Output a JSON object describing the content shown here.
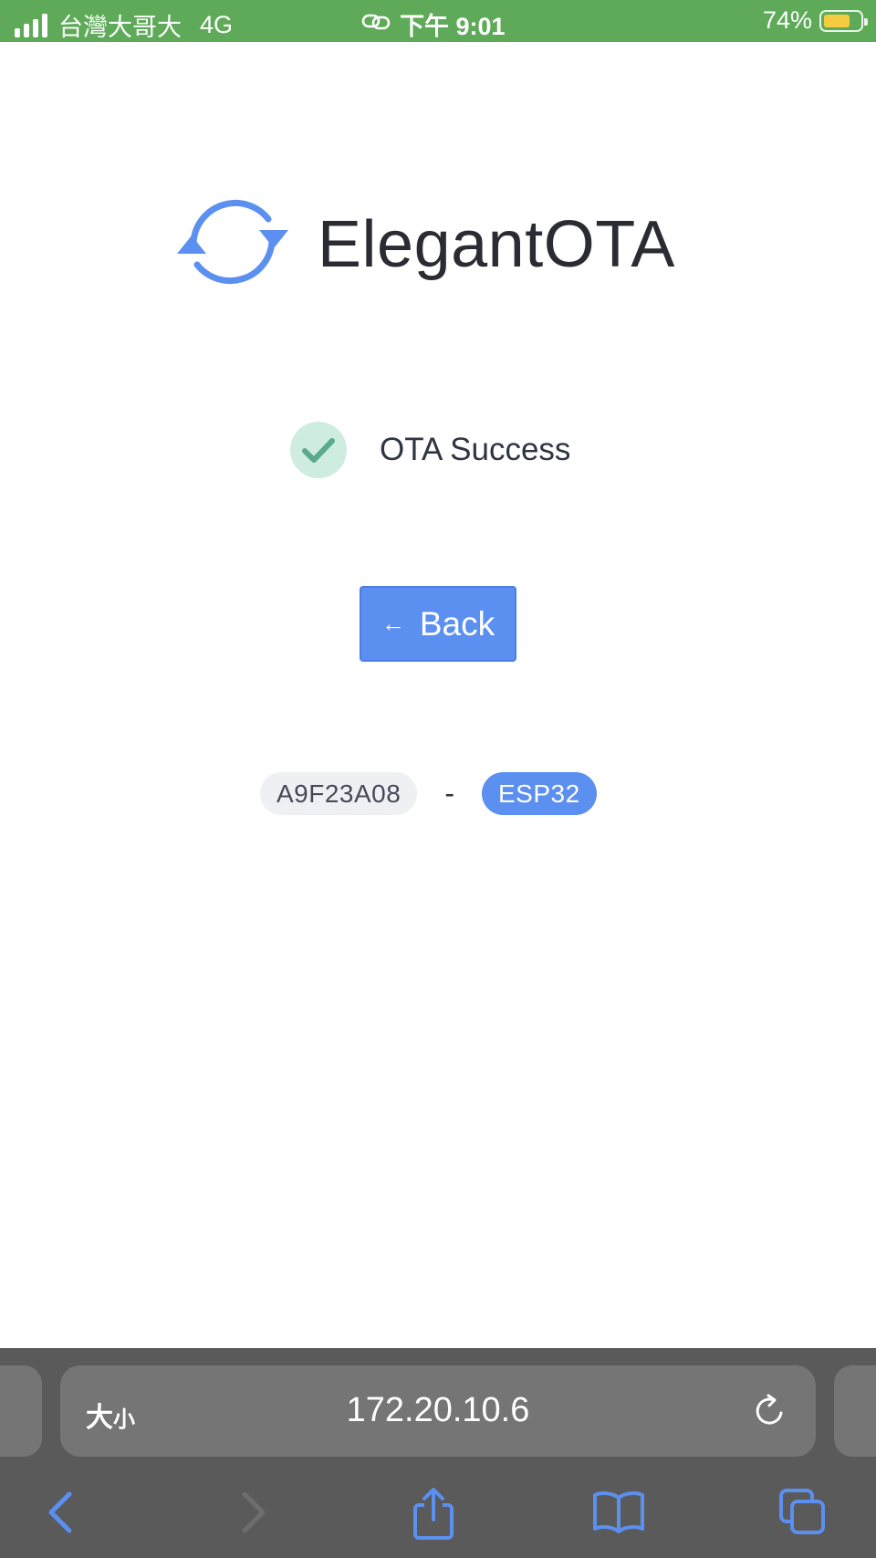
{
  "status_bar": {
    "carrier": "台灣大哥大",
    "network": "4G",
    "time": "下午 9:01",
    "battery": "74%",
    "battery_level": 0.74
  },
  "app": {
    "logo_text": "ElegantOTA",
    "logo_icon": "sync-arrows-icon"
  },
  "result": {
    "message": "OTA Success",
    "icon": "check-icon"
  },
  "back_button": {
    "arrow": "←",
    "label": "Back"
  },
  "device": {
    "id": "A9F23A08",
    "separator": "-",
    "chip": "ESP32"
  },
  "browser": {
    "text_size_label": "大",
    "text_size_small": "小",
    "url": "172.20.10.6",
    "toolbar_icons": [
      "back-icon",
      "forward-icon",
      "share-icon",
      "bookmarks-icon",
      "tabs-icon"
    ]
  },
  "colors": {
    "status_bar": "#5faa58",
    "accent": "#5b8ff0",
    "success_bg": "#cfece1",
    "success": "#5aaa8c"
  }
}
